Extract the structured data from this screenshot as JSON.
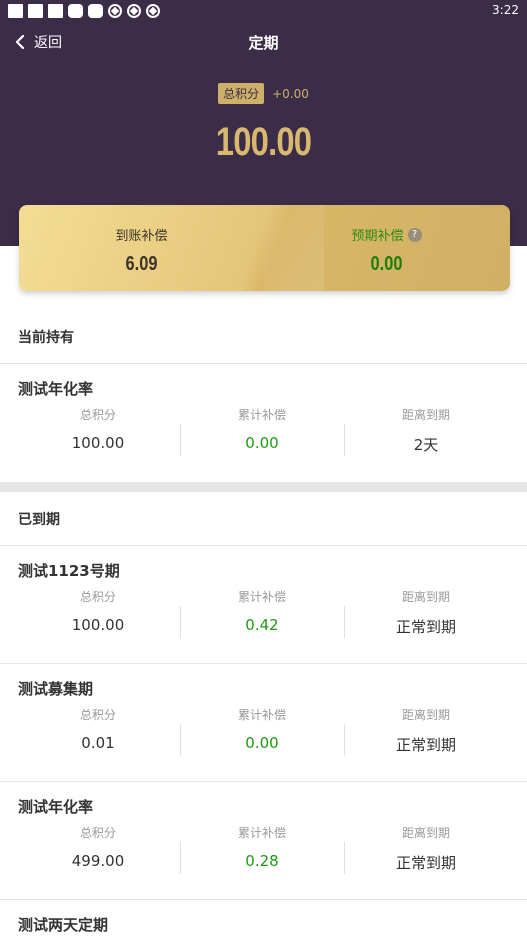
{
  "status": {
    "time": "3:22"
  },
  "nav": {
    "back_label": "返回",
    "title": "定期"
  },
  "total": {
    "badge": "总积分",
    "delta": "+0.00",
    "value": "100.00"
  },
  "card": {
    "received_label": "到账补偿",
    "received_value": "6.09",
    "expected_label": "预期补偿",
    "expected_value": "0.00",
    "help_glyph": "?"
  },
  "current": {
    "title": "当前持有",
    "items": [
      {
        "name": "测试年化率",
        "points_label": "总积分",
        "points": "100.00",
        "comp_label": "累计补偿",
        "comp": "0.00",
        "due_label": "距离到期",
        "due": "2天"
      }
    ]
  },
  "expired": {
    "title": "已到期",
    "items": [
      {
        "name": "测试1123号期",
        "points_label": "总积分",
        "points": "100.00",
        "comp_label": "累计补偿",
        "comp": "0.42",
        "due_label": "距离到期",
        "due": "正常到期"
      },
      {
        "name": "测试募集期",
        "points_label": "总积分",
        "points": "0.01",
        "comp_label": "累计补偿",
        "comp": "0.00",
        "due_label": "距离到期",
        "due": "正常到期"
      },
      {
        "name": "测试年化率",
        "points_label": "总积分",
        "points": "499.00",
        "comp_label": "累计补偿",
        "comp": "0.28",
        "due_label": "距离到期",
        "due": "正常到期"
      },
      {
        "name": "测试两天定期"
      }
    ]
  },
  "colors": {
    "hero": "#3b2c48",
    "gold": "#d8b76e",
    "green": "#1f9a14"
  }
}
